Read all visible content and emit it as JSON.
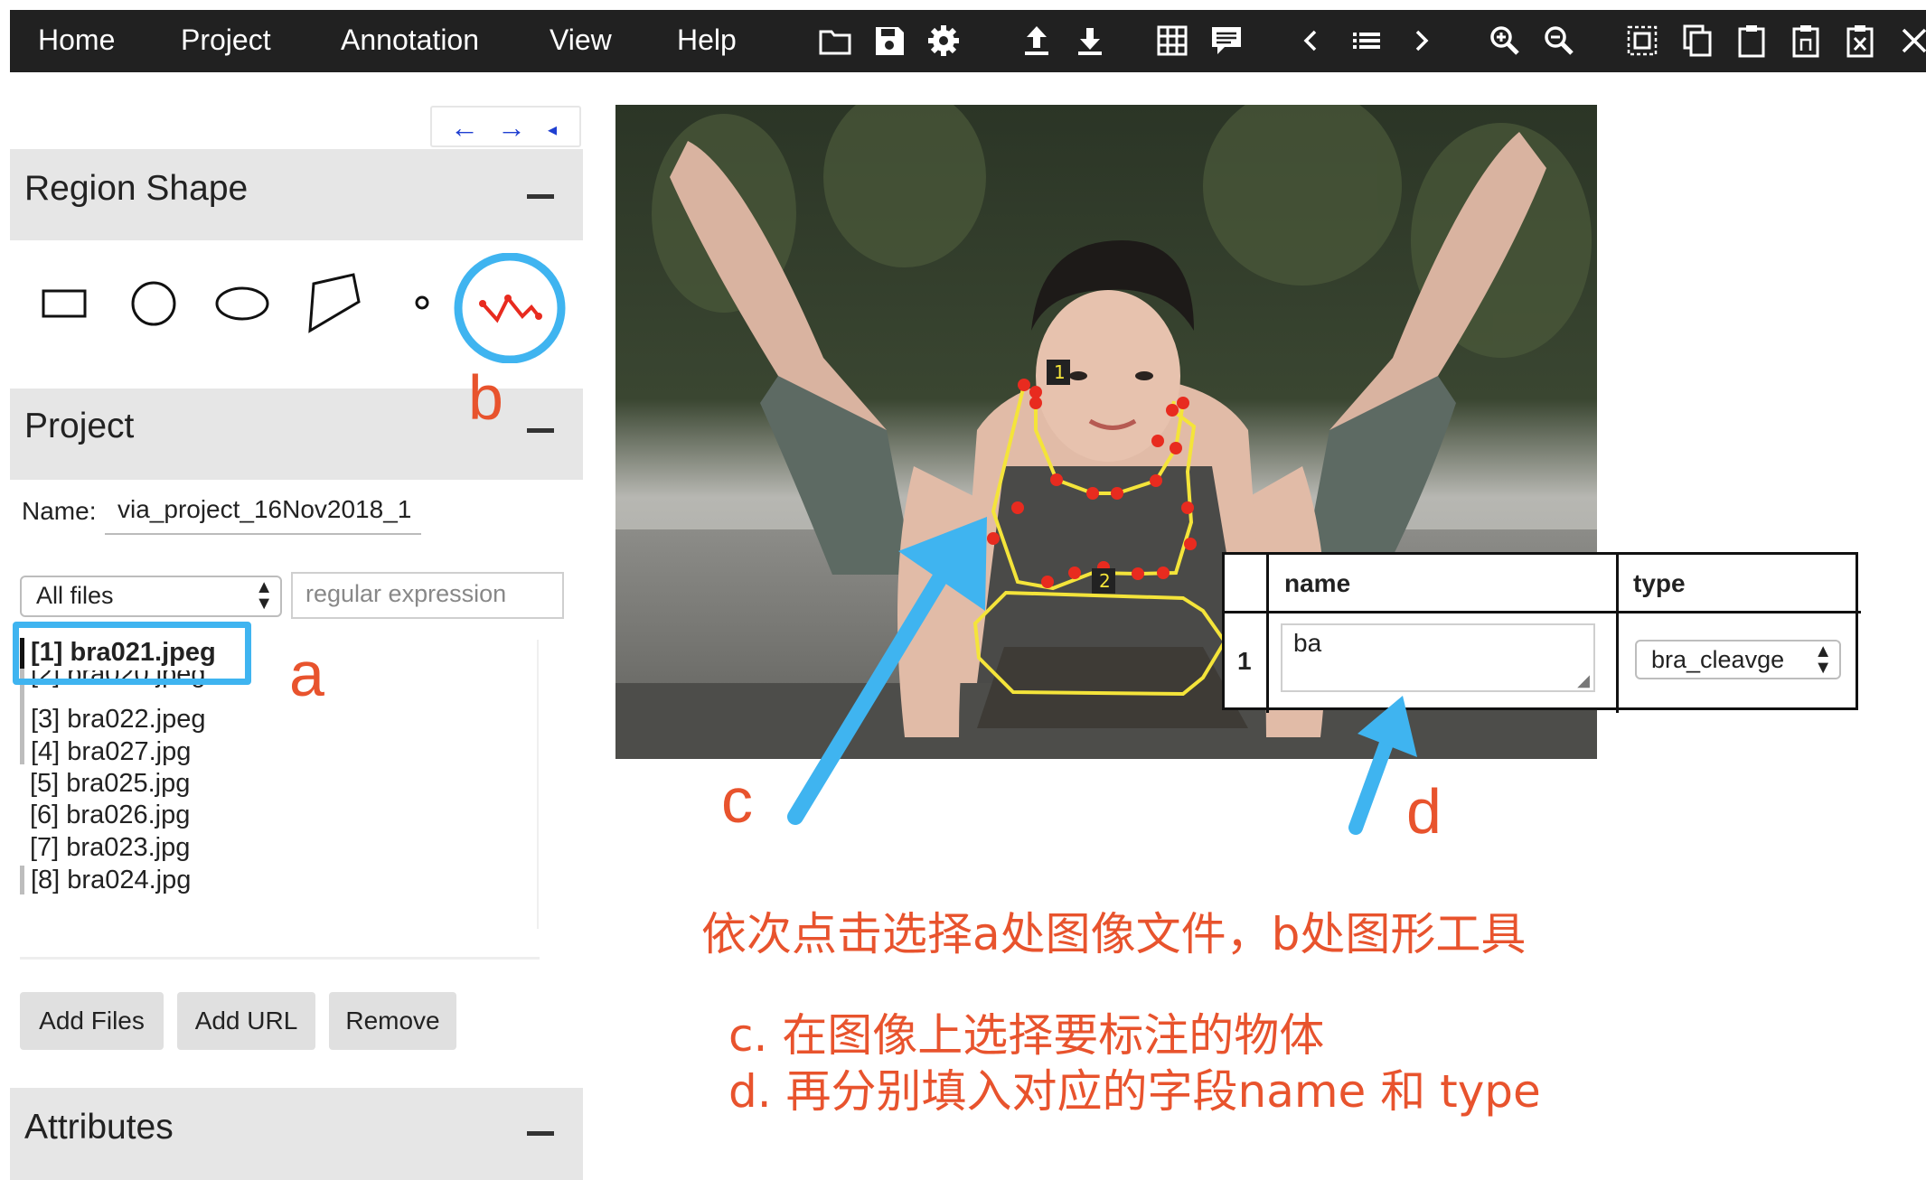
{
  "menubar": {
    "items": [
      "Home",
      "Project",
      "Annotation",
      "View",
      "Help"
    ],
    "toolbar_icons": [
      "folder-open-icon",
      "save-icon",
      "settings-icon",
      "upload-icon",
      "download-icon",
      "grid-view-icon",
      "comment-icon",
      "prev-image-icon",
      "list-icon",
      "next-image-icon",
      "zoom-in-icon",
      "zoom-out-icon",
      "select-all-icon",
      "copy-icon",
      "paste-icon",
      "paste-n-icon",
      "delete-region-icon",
      "close-icon"
    ]
  },
  "nav_arrows": {
    "left": "←",
    "right": "→",
    "small": "◂"
  },
  "region_shape": {
    "title": "Region Shape",
    "shapes": [
      "rectangle",
      "circle",
      "ellipse",
      "polygon",
      "point",
      "polyline"
    ],
    "selected": "polyline"
  },
  "project": {
    "title": "Project",
    "name_label": "Name:",
    "name_value": "via_project_16Nov2018_1",
    "filter_select": "All files",
    "regex_placeholder": "regular expression",
    "files": [
      "[1] bra021.jpeg",
      "[2] bra020.jpeg",
      "[3] bra022.jpeg",
      "[4] bra027.jpg",
      "[5] bra025.jpg",
      "[6] bra026.jpg",
      "[7] bra023.jpg",
      "[8] bra024.jpg"
    ],
    "buttons": {
      "add_files": "Add Files",
      "add_url": "Add URL",
      "remove": "Remove"
    }
  },
  "attributes": {
    "title": "Attributes"
  },
  "attr_table": {
    "col_name": "name",
    "col_type": "type",
    "row_index": "1",
    "name_value": "ba",
    "type_value": "bra_cleavge"
  },
  "annotations": {
    "a": "a",
    "b": "b",
    "c": "c",
    "d": "d",
    "line1": "依次点击选择a处图像文件，b处图形工具",
    "line2": "c. 在图像上选择要标注的物体",
    "line3": "d. 再分别填入对应的字段name 和 type"
  },
  "colors": {
    "menubar_bg": "#212121",
    "accent_blue": "#3fb4f0",
    "annotation_red": "#e8532d",
    "polyline_yellow": "#f4e43a",
    "point_red": "#e82b1f"
  }
}
